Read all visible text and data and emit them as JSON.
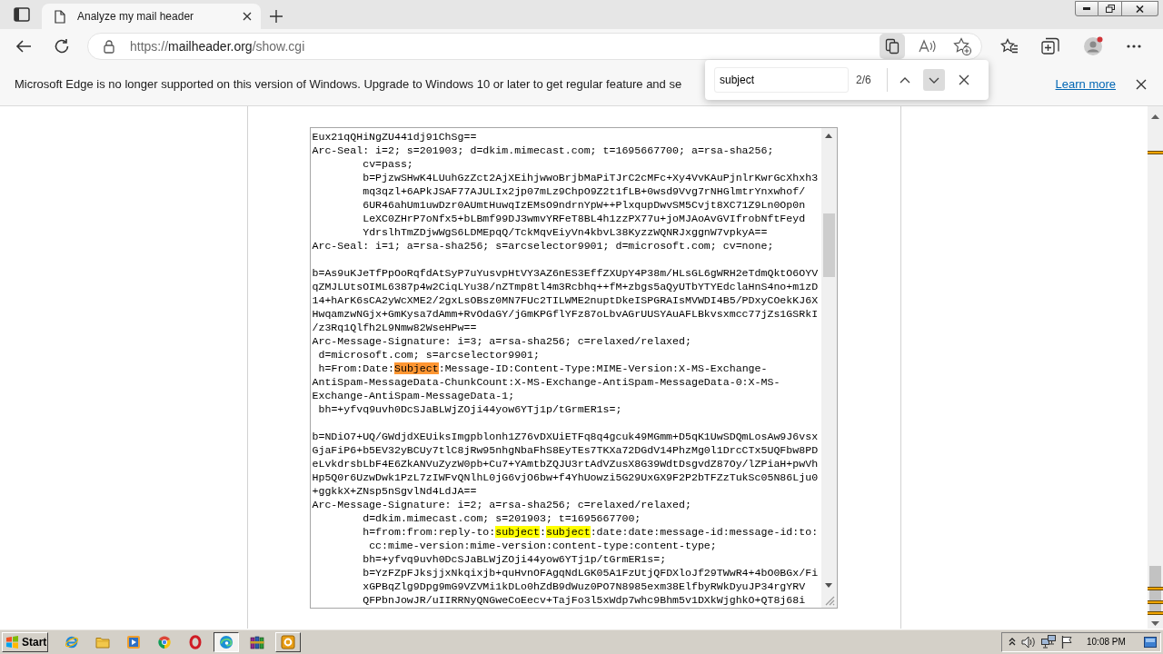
{
  "tabs": [
    {
      "title": "Analyze my mail header",
      "selected": true
    }
  ],
  "address_bar": {
    "scheme": "https://",
    "host": "mailheader.org",
    "path": "/show.cgi"
  },
  "info_bar": {
    "message": "Microsoft Edge is no longer supported on this version of Windows. Upgrade to Windows 10 or later to get regular feature and se",
    "link": "Learn more"
  },
  "find_bar": {
    "query": "subject",
    "count": "2/6",
    "previous_button": {
      "hovered": false
    },
    "next_button": {
      "hovered": true
    }
  },
  "header_textarea": {
    "lines": [
      {
        "kind": "text",
        "text": "Eux21qQHiNgZU441dj91ChSg=="
      },
      {
        "kind": "text",
        "text": "Arc-Seal: i=2; s=201903; d=dkim.mimecast.com; t=1695667700; a=rsa-sha256;"
      },
      {
        "kind": "text",
        "text": "        cv=pass;"
      },
      {
        "kind": "text",
        "text": "        b=PjzwSHwK4LUuhGzZct2AjXEihjwwoBrjbMaPiTJrC2cMFc+Xy4VvKAuPjnlrKwrGcXhxh3"
      },
      {
        "kind": "text",
        "text": "        mq3qzl+6APkJSAF77AJULIx2jp07mLz9ChpO9Z2t1fLB+0wsd9Vvg7rNHGlmtrYnxwhof/"
      },
      {
        "kind": "text",
        "text": "        6UR46ahUm1uwDzr0AUmtHuwqIzEMsO9ndrnYpW++PlxqupDwvSM5Cvjt8XC71Z9Ln0Op0n"
      },
      {
        "kind": "text",
        "text": "        LeXC0ZHrP7oNfx5+bLBmf99DJ3wmvYRFeT8BL4h1zzPX77u+joMJAoAvGVIfrobNftFeyd"
      },
      {
        "kind": "text",
        "text": "        YdrslhTmZDjwWgS6LDMEpqQ/TckMqvEiyVn4kbvL38KyzzWQNRJxggnW7vpkyA=="
      },
      {
        "kind": "text",
        "text": "Arc-Seal: i=1; a=rsa-sha256; s=arcselector9901; d=microsoft.com; cv=none;"
      },
      {
        "kind": "blank"
      },
      {
        "kind": "text",
        "text": "b=As9uKJeTfPpOoRqfdAtSyP7uYusvpHtVY3AZ6nES3EffZXUpY4P38m/HLsGL6gWRH2eTdmQktO6OYV"
      },
      {
        "kind": "text",
        "text": "qZMJLUtsOIML6387p4w2CiqLYu38/nZTmp8tl4m3Rcbhq++fM+zbgs5aQyUTbYTYEdclaHnS4no+m1zD"
      },
      {
        "kind": "text",
        "text": "14+hArK6sCA2yWcXME2/2gxLsOBsz0MN7FUc2TILWME2nuptDkeISPGRAIsMVWDI4B5/PDxyCOekKJ6X"
      },
      {
        "kind": "text",
        "text": "HwqamzwNGjx+GmKysa7dAmm+RvOdaGY/jGmKPGflYFz87oLbvAGrUUSYAuAFLBkvsxmcc77jZs1GSRkI"
      },
      {
        "kind": "text",
        "text": "/z3Rq1Qlfh2L9Nmw82WseHPw=="
      },
      {
        "kind": "text",
        "text": "Arc-Message-Signature: i=3; a=rsa-sha256; c=relaxed/relaxed;"
      },
      {
        "kind": "text",
        "text": " d=microsoft.com; s=arcselector9901;"
      },
      {
        "kind": "marked",
        "segments": [
          {
            "text": " h=From:Date:",
            "highlighted": false,
            "selected": false
          },
          {
            "text": "Subject",
            "highlighted": true,
            "selected": true
          },
          {
            "text": ":Message-ID:Content-Type:MIME-Version:X-MS-Exchange-",
            "highlighted": false,
            "selected": false
          }
        ]
      },
      {
        "kind": "text",
        "text": "AntiSpam-MessageData-ChunkCount:X-MS-Exchange-AntiSpam-MessageData-0:X-MS-"
      },
      {
        "kind": "text",
        "text": "Exchange-AntiSpam-MessageData-1;"
      },
      {
        "kind": "text",
        "text": " bh=+yfvq9uvh0DcSJaBLWjZOji44yow6YTj1p/tGrmER1s=;"
      },
      {
        "kind": "blank"
      },
      {
        "kind": "text",
        "text": "b=NDiO7+UQ/GWdjdXEUiksImgpblonh1Z76vDXUiETFq8q4gcuk49MGmm+D5qK1UwSDQmLosAw9J6vsx"
      },
      {
        "kind": "text",
        "text": "GjaFiP6+b5EV32yBCUy7tlC8jRw95nhgNbaFhS8EyTEs7TKXa72DGdV14PhzMg0l1DrcCTx5UQFbw8PD"
      },
      {
        "kind": "text",
        "text": "eLvkdrsbLbF4E6ZkANVuZyzW0pb+Cu7+YAmtbZQJU3rtAdVZusX8G39WdtDsgvdZ87Oy/lZPiaH+pwVh"
      },
      {
        "kind": "text",
        "text": "Hp5Q0r6UzwDwk1PzL7zIWFvQNlhL0jG6vjO6bw+f4YhUowzi5G29UxGX9F2P2bTFZzTukSc05N86Lju0"
      },
      {
        "kind": "text",
        "text": "+ggkkX+ZNsp5nSgvlNd4LdJA=="
      },
      {
        "kind": "text",
        "text": "Arc-Message-Signature: i=2; a=rsa-sha256; c=relaxed/relaxed;"
      },
      {
        "kind": "text",
        "text": "        d=dkim.mimecast.com; s=201903; t=1695667700;"
      },
      {
        "kind": "marked",
        "segments": [
          {
            "text": "        h=from:from:reply-to:",
            "highlighted": false,
            "selected": false
          },
          {
            "text": "subject",
            "highlighted": true,
            "selected": false
          },
          {
            "text": ":",
            "highlighted": false,
            "selected": false
          },
          {
            "text": "subject",
            "highlighted": true,
            "selected": false
          },
          {
            "text": ":date:date:message-id:message-id:to:",
            "highlighted": false,
            "selected": false
          }
        ]
      },
      {
        "kind": "text",
        "text": "         cc:mime-version:mime-version:content-type:content-type;"
      },
      {
        "kind": "text",
        "text": "        bh=+yfvq9uvh0DcSJaBLWjZOji44yow6YTj1p/tGrmER1s=;"
      },
      {
        "kind": "text",
        "text": "        b=YzFZpFJksjjxNkqixjb+quHvnOFAgqNdLGK05A1FzUtjQFDXloJf29TWwR4+4bO0BGx/Fi"
      },
      {
        "kind": "text",
        "text": "        xGPBqZlg9Dpg9mG9VZVMi1kDLo0hZdB9dWuz0PO7N8985exm38ElfbyRWkDyuJP34rgYRV"
      },
      {
        "kind": "text",
        "text": "        QFPbnJowJR/uIIRRNyQNGweCoEecv+TajFo3l5xWdp7whc9Bhm5v1DXkWjghkO+QT8j68i"
      }
    ]
  },
  "taskbar": {
    "start": "Start",
    "apps": [
      {
        "running": false,
        "selected": false
      },
      {
        "running": false,
        "selected": false
      },
      {
        "running": false,
        "selected": false
      },
      {
        "running": false,
        "selected": false
      },
      {
        "running": false,
        "selected": false
      },
      {
        "running": true,
        "selected": true
      },
      {
        "running": false,
        "selected": false
      },
      {
        "running": true,
        "selected": false
      }
    ],
    "clock": "10:08 PM"
  }
}
